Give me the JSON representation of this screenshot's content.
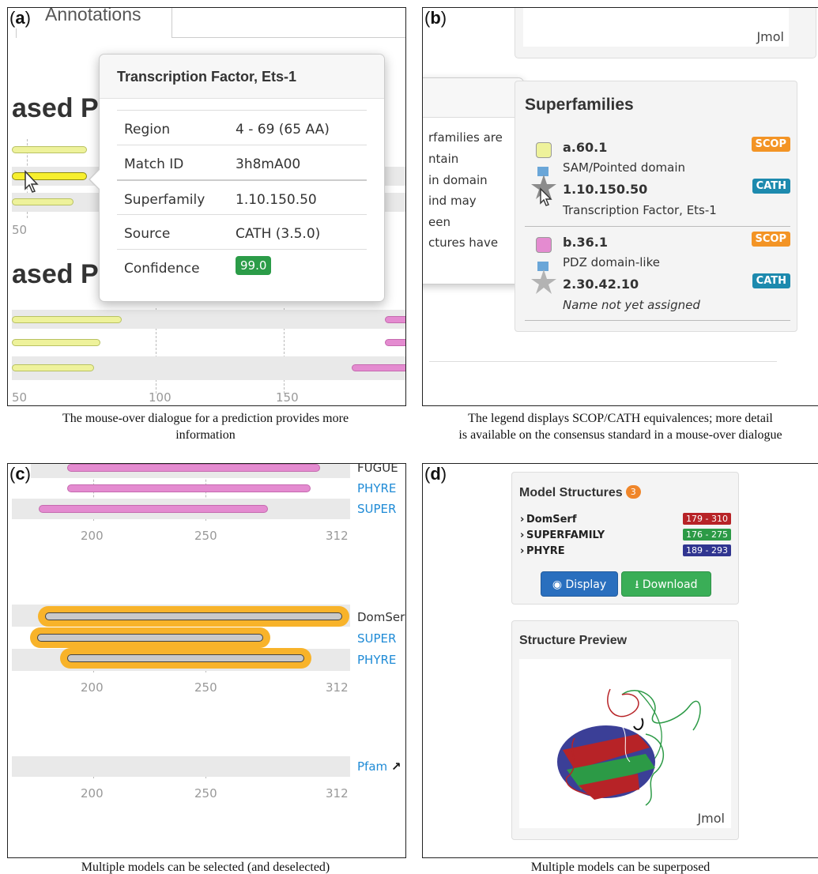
{
  "panel_a": {
    "letter": "a",
    "tab_label": "Annotations",
    "heading1": "ased P",
    "heading2": "ased P",
    "upper_ticks": [
      "50"
    ],
    "lower_ticks": [
      "50",
      "100",
      "150"
    ],
    "tooltip": {
      "title": "Transcription Factor, Ets-1",
      "rows": [
        {
          "key": "Region",
          "value": "4 - 69 (65 AA)"
        },
        {
          "key": "Match ID",
          "value": "3h8mA00"
        },
        {
          "key": "Superfamily",
          "value": "1.10.150.50"
        },
        {
          "key": "Source",
          "value": "CATH (3.5.0)"
        },
        {
          "key": "Confidence",
          "value": "99.0"
        }
      ],
      "confidence_color": "#2b9c48"
    },
    "caption_line1": "The mouse-over dialogue for a prediction provides more",
    "caption_line2": "information"
  },
  "panel_b": {
    "letter": "b",
    "viewer_label": "Jmol",
    "legend_title": "Superfamilies",
    "popover_lines": [
      "rfamilies are",
      "ntain",
      "in domain",
      "ind may",
      "een",
      "ctures have"
    ],
    "entries": [
      {
        "scop_code": "a.60.1",
        "scop_desc": "SAM/Pointed domain",
        "scop_tag": "SCOP",
        "cath_code": "1.10.150.50",
        "cath_desc": "Transcription Factor, Ets-1",
        "cath_tag": "CATH",
        "color": "#eef29b"
      },
      {
        "scop_code": "b.36.1",
        "scop_desc": "PDZ domain-like",
        "scop_tag": "SCOP",
        "cath_code": "2.30.42.10",
        "cath_desc": "Name not yet assigned",
        "cath_tag": "CATH",
        "color": "#e48bd0"
      }
    ],
    "caption_line1": "The legend displays SCOP/CATH equivalences; more detail",
    "caption_line2": "is available on the consensus standard in a mouse-over dialogue"
  },
  "panel_c": {
    "letter": "c",
    "top_labels": [
      "FUGUE",
      "PHYRE",
      "SUPER"
    ],
    "mid_labels": [
      "DomSer",
      "SUPER",
      "PHYRE"
    ],
    "bottom_label": "Pfam",
    "ticks": [
      "200",
      "250",
      "312"
    ],
    "selection_color": "#f8b32a",
    "caption": "Multiple models can be selected (and deselected)"
  },
  "panel_d": {
    "letter": "d",
    "models_title": "Model Structures",
    "models_count": "3",
    "models": [
      {
        "name": "DomSerf",
        "range": "179 - 310",
        "color": "#b72327"
      },
      {
        "name": "SUPERFAMILY",
        "range": "176 - 275",
        "color": "#2c9a46"
      },
      {
        "name": "PHYRE",
        "range": "189 - 293",
        "color": "#303590"
      }
    ],
    "display_button": "Display",
    "download_button": "Download",
    "preview_title": "Structure Preview",
    "viewer_label": "Jmol",
    "caption": "Multiple models can be superposed"
  }
}
